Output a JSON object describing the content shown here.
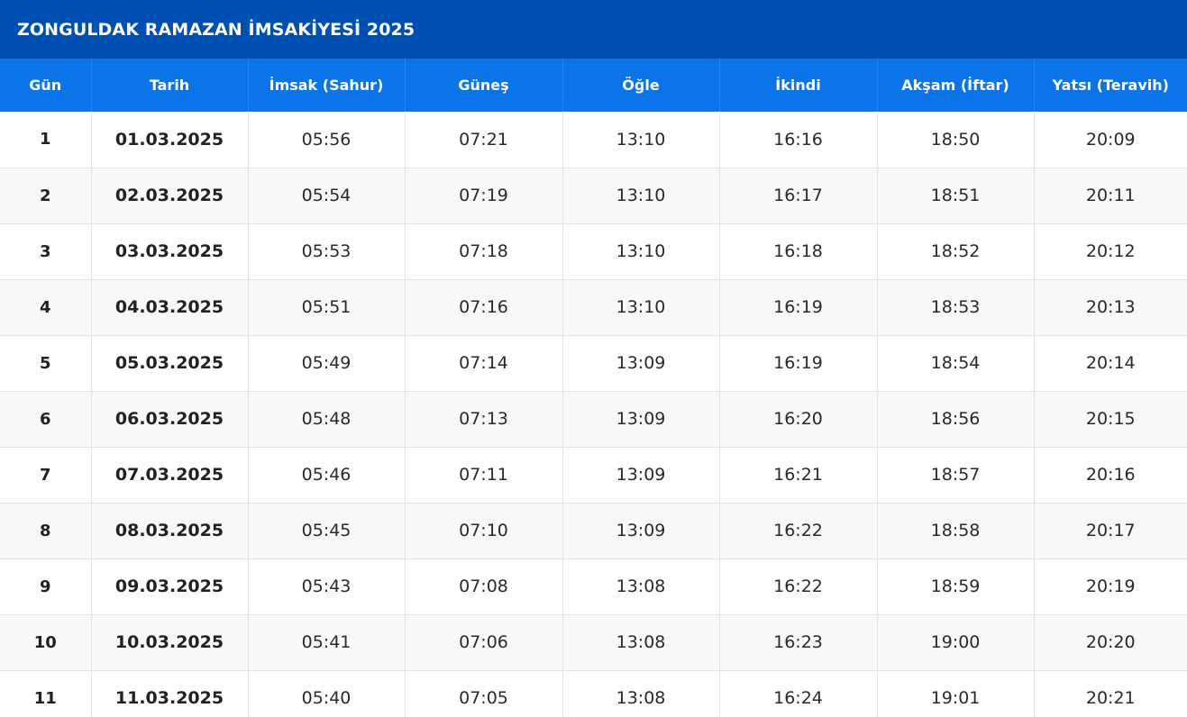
{
  "header": {
    "title": "ZONGULDAK RAMAZAN İMSAKİYESİ 2025"
  },
  "colors": {
    "title_bg": "#0050b3",
    "header_bg": "#0a74e8",
    "row_alt_bg": "#f8f8f8"
  },
  "table": {
    "columns": [
      "Gün",
      "Tarih",
      "İmsak (Sahur)",
      "Güneş",
      "Öğle",
      "İkindi",
      "Akşam (İftar)",
      "Yatsı (Teravih)"
    ],
    "rows": [
      [
        "1",
        "01.03.2025",
        "05:56",
        "07:21",
        "13:10",
        "16:16",
        "18:50",
        "20:09"
      ],
      [
        "2",
        "02.03.2025",
        "05:54",
        "07:19",
        "13:10",
        "16:17",
        "18:51",
        "20:11"
      ],
      [
        "3",
        "03.03.2025",
        "05:53",
        "07:18",
        "13:10",
        "16:18",
        "18:52",
        "20:12"
      ],
      [
        "4",
        "04.03.2025",
        "05:51",
        "07:16",
        "13:10",
        "16:19",
        "18:53",
        "20:13"
      ],
      [
        "5",
        "05.03.2025",
        "05:49",
        "07:14",
        "13:09",
        "16:19",
        "18:54",
        "20:14"
      ],
      [
        "6",
        "06.03.2025",
        "05:48",
        "07:13",
        "13:09",
        "16:20",
        "18:56",
        "20:15"
      ],
      [
        "7",
        "07.03.2025",
        "05:46",
        "07:11",
        "13:09",
        "16:21",
        "18:57",
        "20:16"
      ],
      [
        "8",
        "08.03.2025",
        "05:45",
        "07:10",
        "13:09",
        "16:22",
        "18:58",
        "20:17"
      ],
      [
        "9",
        "09.03.2025",
        "05:43",
        "07:08",
        "13:08",
        "16:22",
        "18:59",
        "20:19"
      ],
      [
        "10",
        "10.03.2025",
        "05:41",
        "07:06",
        "13:08",
        "16:23",
        "19:00",
        "20:20"
      ],
      [
        "11",
        "11.03.2025",
        "05:40",
        "07:05",
        "13:08",
        "16:24",
        "19:01",
        "20:21"
      ]
    ]
  }
}
